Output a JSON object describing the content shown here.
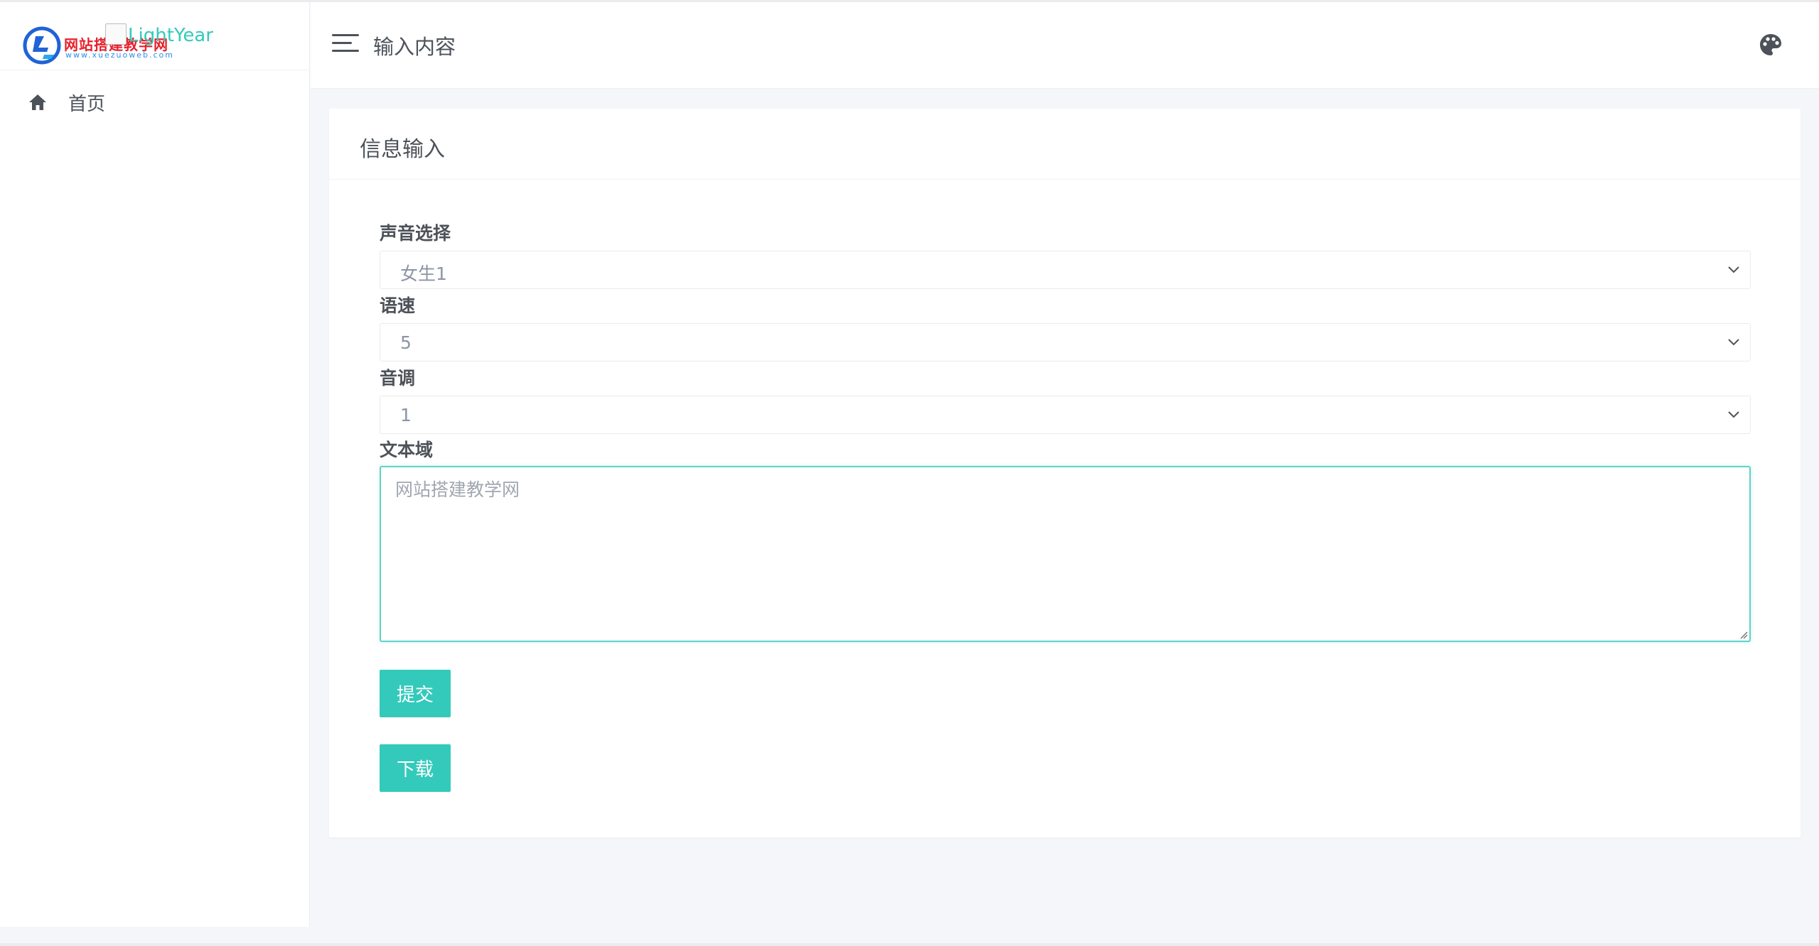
{
  "logo": {
    "brand_text": "网站搭建教学网",
    "brand_url": "www.xuezuoweb.com",
    "alt_text": "LightYear"
  },
  "sidebar": {
    "items": [
      {
        "label": "首页",
        "icon": "home-icon"
      }
    ]
  },
  "header": {
    "title": "输入内容",
    "right_icon": "palette-icon"
  },
  "card": {
    "title": "信息输入",
    "fields": {
      "voice": {
        "label": "声音选择",
        "value": "女生1"
      },
      "speed": {
        "label": "语速",
        "value": "5"
      },
      "pitch": {
        "label": "音调",
        "value": "1"
      },
      "text": {
        "label": "文本域",
        "placeholder": "网站搭建教学网"
      }
    },
    "buttons": {
      "submit": "提交",
      "download": "下载"
    }
  },
  "colors": {
    "accent": "#33cabb",
    "text": "#4d5259",
    "brand_red": "#e8202b",
    "brand_blue": "#2b8ee6"
  }
}
